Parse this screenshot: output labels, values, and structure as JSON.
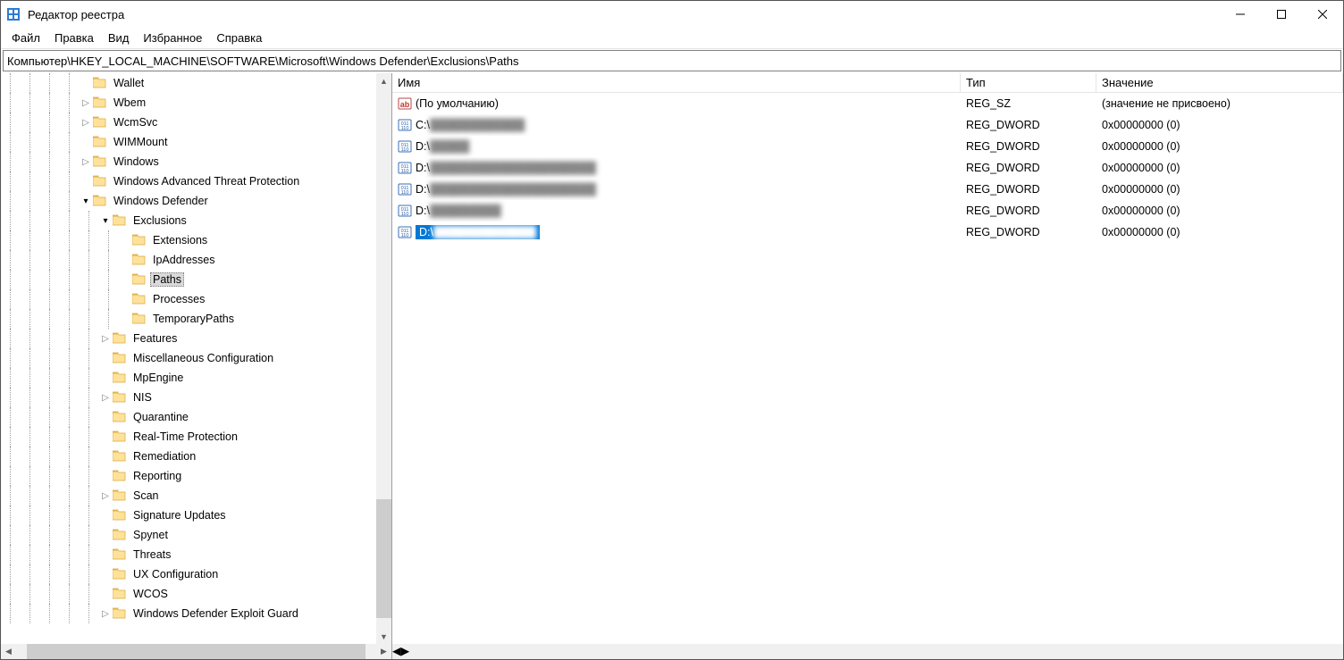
{
  "app": {
    "title": "Редактор реестра"
  },
  "window_controls": {
    "min": "—",
    "max": "☐",
    "close": "✕"
  },
  "menu": {
    "file": "Файл",
    "edit": "Правка",
    "view": "Вид",
    "fav": "Избранное",
    "help": "Справка"
  },
  "address": "Компьютер\\HKEY_LOCAL_MACHINE\\SOFTWARE\\Microsoft\\Windows Defender\\Exclusions\\Paths",
  "tree": [
    {
      "depth": 4,
      "exp": null,
      "label": "Wallet"
    },
    {
      "depth": 4,
      "exp": "closed",
      "label": "Wbem"
    },
    {
      "depth": 4,
      "exp": "closed",
      "label": "WcmSvc"
    },
    {
      "depth": 4,
      "exp": null,
      "label": "WIMMount"
    },
    {
      "depth": 4,
      "exp": "closed",
      "label": "Windows"
    },
    {
      "depth": 4,
      "exp": null,
      "label": "Windows Advanced Threat Protection"
    },
    {
      "depth": 4,
      "exp": "open",
      "label": "Windows Defender"
    },
    {
      "depth": 5,
      "exp": "open",
      "label": "Exclusions"
    },
    {
      "depth": 6,
      "exp": null,
      "label": "Extensions"
    },
    {
      "depth": 6,
      "exp": null,
      "label": "IpAddresses"
    },
    {
      "depth": 6,
      "exp": null,
      "label": "Paths",
      "selected": true
    },
    {
      "depth": 6,
      "exp": null,
      "label": "Processes"
    },
    {
      "depth": 6,
      "exp": null,
      "label": "TemporaryPaths"
    },
    {
      "depth": 5,
      "exp": "closed",
      "label": "Features"
    },
    {
      "depth": 5,
      "exp": null,
      "label": "Miscellaneous Configuration"
    },
    {
      "depth": 5,
      "exp": null,
      "label": "MpEngine"
    },
    {
      "depth": 5,
      "exp": "closed",
      "label": "NIS"
    },
    {
      "depth": 5,
      "exp": null,
      "label": "Quarantine"
    },
    {
      "depth": 5,
      "exp": null,
      "label": "Real-Time Protection"
    },
    {
      "depth": 5,
      "exp": null,
      "label": "Remediation"
    },
    {
      "depth": 5,
      "exp": null,
      "label": "Reporting"
    },
    {
      "depth": 5,
      "exp": "closed",
      "label": "Scan"
    },
    {
      "depth": 5,
      "exp": null,
      "label": "Signature Updates"
    },
    {
      "depth": 5,
      "exp": null,
      "label": "Spynet"
    },
    {
      "depth": 5,
      "exp": null,
      "label": "Threats"
    },
    {
      "depth": 5,
      "exp": null,
      "label": "UX Configuration"
    },
    {
      "depth": 5,
      "exp": null,
      "label": "WCOS"
    },
    {
      "depth": 5,
      "exp": "closed",
      "label": "Windows Defender Exploit Guard"
    }
  ],
  "columns": {
    "name": "Имя",
    "type": "Тип",
    "value": "Значение"
  },
  "rows": [
    {
      "icon": "string",
      "name_prefix": "",
      "name": "(По умолчанию)",
      "blurred": false,
      "type": "REG_SZ",
      "value": "(значение не присвоено)",
      "selected": false
    },
    {
      "icon": "binary",
      "name_prefix": "C:\\",
      "name": "",
      "blurred": true,
      "type": "REG_DWORD",
      "value": "0x00000000 (0)",
      "selected": false
    },
    {
      "icon": "binary",
      "name_prefix": "D:\\",
      "name": "",
      "blurred": true,
      "type": "REG_DWORD",
      "value": "0x00000000 (0)",
      "selected": false
    },
    {
      "icon": "binary",
      "name_prefix": "D:\\",
      "name": "",
      "blurred": true,
      "type": "REG_DWORD",
      "value": "0x00000000 (0)",
      "selected": false
    },
    {
      "icon": "binary",
      "name_prefix": "D:\\",
      "name": "",
      "blurred": true,
      "type": "REG_DWORD",
      "value": "0x00000000 (0)",
      "selected": false
    },
    {
      "icon": "binary",
      "name_prefix": "D:\\",
      "name": "",
      "blurred": true,
      "type": "REG_DWORD",
      "value": "0x00000000 (0)",
      "selected": false
    },
    {
      "icon": "binary",
      "name_prefix": "D:\\",
      "name": "",
      "blurred": true,
      "type": "REG_DWORD",
      "value": "0x00000000 (0)",
      "selected": true
    }
  ]
}
